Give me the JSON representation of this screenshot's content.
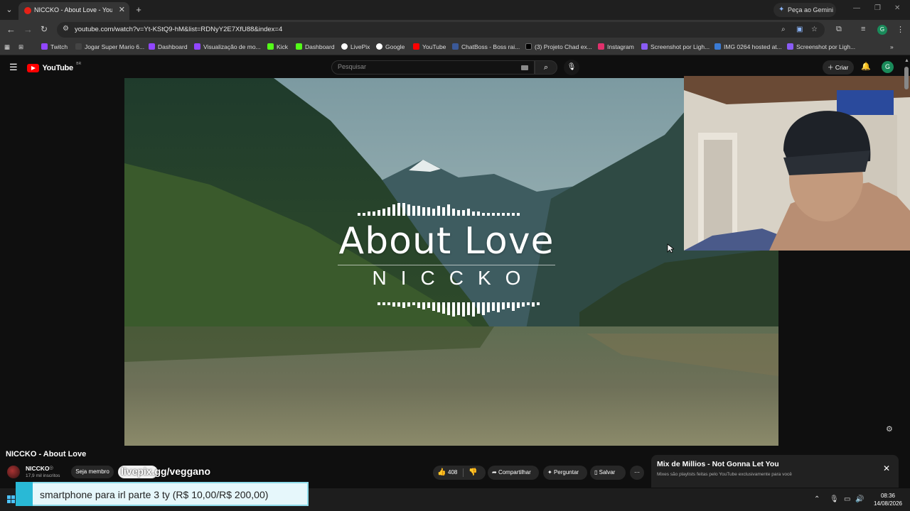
{
  "browser": {
    "tab_title": "NICCKO - About Love - YouTube",
    "new_tab": "+",
    "gemini_label": "Peça ao Gemini",
    "url": "youtube.com/watch?v=Yt-KStQ9-hM&list=RDNyY2E7XfU88&index=4",
    "profile_initial": "G",
    "bookmarks": [
      {
        "label": "Twitch",
        "color": "#9146ff"
      },
      {
        "label": "Jogar Super Mario 6...",
        "color": "#333"
      },
      {
        "label": "Dashboard",
        "color": "#9146ff"
      },
      {
        "label": "Visualização de mo...",
        "color": "#9146ff"
      },
      {
        "label": "Kick",
        "color": "#53fc18"
      },
      {
        "label": "Dashboard",
        "color": "#53fc18"
      },
      {
        "label": "LivePix",
        "color": "#ffffff"
      },
      {
        "label": "Google",
        "color": "#ffffff"
      },
      {
        "label": "YouTube",
        "color": "#ff0000"
      },
      {
        "label": "ChatBoss - Boss rai...",
        "color": "#3b5998"
      },
      {
        "label": "(3) Projeto Chad ex...",
        "color": "#000000"
      },
      {
        "label": "Instagram",
        "color": "#e1306c"
      },
      {
        "label": "Screenshot por Ligh...",
        "color": "#8a5cf5"
      },
      {
        "label": "IMG 0264 hosted at...",
        "color": "#3a7bd5"
      },
      {
        "label": "Screenshot por Ligh...",
        "color": "#8a5cf5"
      }
    ]
  },
  "youtube": {
    "logo_text": "YouTube",
    "logo_cc": "BR",
    "search_placeholder": "Pesquisar",
    "create_label": "Criar",
    "avatar_initial": "G"
  },
  "video": {
    "title_main": "About Love",
    "title_artist": "NICCKO"
  },
  "info": {
    "title": "NICCKO - About Love",
    "channel": "NICCKO",
    "subscribers": "17,9 mil inscritos",
    "member_label": "Seja membro",
    "overlay_text": "livepix.gg/veggano",
    "likes": "408",
    "share_label": "Compartilhar",
    "ask_label": "Perguntar",
    "save_label": "Salvar"
  },
  "mix": {
    "title": "Mix de Millios - Not Gonna Let You",
    "subtitle": "Mixes são playlists feitas pelo YouTube exclusivamente para você"
  },
  "donation": {
    "text": "smartphone para irl parte 3 ty (R$ 10,00/R$ 200,00)",
    "progress_fraction": 0.05
  },
  "taskbar": {
    "time": "08:36",
    "date": "14/08/2026"
  },
  "colors": {
    "youtube_red": "#ff0000",
    "donation_accent": "#29b9d6"
  }
}
